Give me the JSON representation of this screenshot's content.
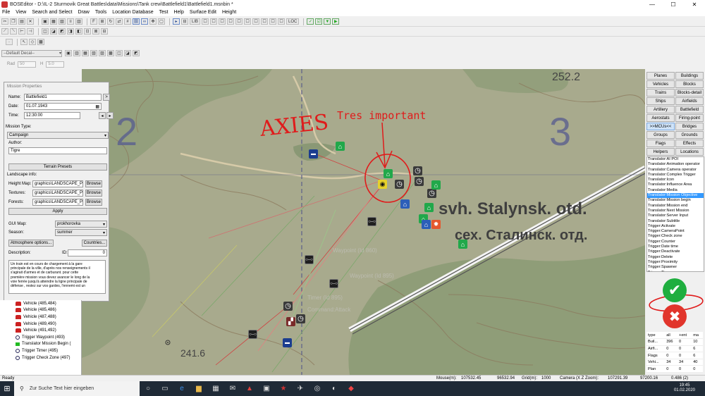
{
  "window": {
    "title": "BOSEditor - D:\\IL-2 Sturmovik Great Battles\\data\\Missions\\Tank crew\\Battlefield1\\Battlefield1.msnbin *",
    "controls": [
      "—",
      "☐",
      "✕"
    ]
  },
  "menu": [
    "File",
    "View",
    "Search and Select",
    "Draw",
    "Tools",
    "Location Database",
    "Test",
    "Help",
    "Surface Edit",
    "Height"
  ],
  "toolbar": {
    "text_buttons": [
      "LIB",
      "LOC"
    ]
  },
  "decal": {
    "selected": "--Default Decal--",
    "rad_label": "Rad",
    "rad_value": "50",
    "h_label": "H",
    "h_value": "5.0"
  },
  "mission": {
    "panel_title": "Mission Properties",
    "name_label": "Name:",
    "name_value": "Battlefield1",
    "date_label": "Date:",
    "date_value": "01.07.1943",
    "time_label": "Time:",
    "time_value": "12:30:00",
    "type_label": "Mission Type:",
    "type_value": "Campaign",
    "author_label": "Author:",
    "author_value": "Tigre",
    "terrain_presets": "Terrain Presets",
    "landscape_label": "Landscape info:",
    "heightmap_label": "Height Map:",
    "heightmap_value": "graphics\\LANDSCAPE_Prokh",
    "textures_label": "Textures:",
    "textures_value": "graphics\\LANDSCAPE_Prokh",
    "forests_label": "Forests:",
    "forests_value": "graphics\\LANDSCAPE_Prokh",
    "browse": "Browse",
    "apply": "Apply",
    "gui_map_label": "GUI Map:",
    "gui_map_value": "prokhorovka",
    "season_label": "Season:",
    "season_value": "summer",
    "atmo_button": "Atmosphere options...",
    "countries_button": "Countries...",
    "description_label": "Description:",
    "id_label": "ID:",
    "id_value": "0",
    "description_lines": [
      "Un train est en cours de chargement à la gare",
      "principale de la ville, d'après nos renseignements il",
      "s'agirait d'armes et de carburant.      pour cette",
      "première mission vous devez avancer le long de la",
      "voie ferrée jusqu'à atteindre la ligne principale de",
      "défense ,  restez sur vos gardes, l'ennemi est un"
    ]
  },
  "object_list": [
    {
      "icon": "tank-icon",
      "label": "Vehicle (485,484)"
    },
    {
      "icon": "tank-icon",
      "label": "Vehicle (485,486)"
    },
    {
      "icon": "tank-icon",
      "label": "Vehicle (487,488)"
    },
    {
      "icon": "tank-icon",
      "label": "Vehicle (489,490)"
    },
    {
      "icon": "tank-icon",
      "label": "Vehicle (491,492)"
    },
    {
      "icon": "waypoint-icon",
      "label": "Trigger Waypoint (493)"
    },
    {
      "icon": "flag-icon",
      "label": "Translator Mission Begin ("
    },
    {
      "icon": "timer-icon",
      "label": "Trigger Timer (495)"
    },
    {
      "icon": "check-icon",
      "label": "Trigger Check Zone (497)"
    }
  ],
  "categories": [
    {
      "left": "Planes",
      "right": "Buildings"
    },
    {
      "left": "Vehicles",
      "right": "Blocks"
    },
    {
      "left": "Trains",
      "right": "Blocks-detail"
    },
    {
      "left": "Ships",
      "right": "Airfields"
    },
    {
      "left": "Artillery",
      "right": "Battlefield"
    },
    {
      "left": "Aerostats",
      "right": "Firing-point"
    },
    {
      "left": ">>MCUs<<",
      "right": "Bridges"
    },
    {
      "left": "Groups",
      "right": "Grounds"
    },
    {
      "left": "Flags",
      "right": "Effects"
    },
    {
      "left": "Helpers",
      "right": "Locations"
    }
  ],
  "mcu_list": [
    "Translator:AI POI",
    "Translator:Animation operator",
    "Translator:Camera operator",
    "Translator:Complex Trigger",
    "Translator:Icon",
    "Translator:Influence Area",
    "Translator:Media",
    "Translator:Mission Objective",
    "Translator:Mission begin",
    "Translator:Mission end",
    "Translator:Next Mission",
    "Translator:Server Input",
    "Translator:Subtitle",
    "Trigger:Activate",
    "Trigger:CameraPoint",
    "Trigger:Check zone",
    "Trigger:Counter",
    "Trigger:Date time",
    "Trigger:Deactivate",
    "Trigger:Delete",
    "Trigger:Proximity",
    "Trigger:Spawner",
    "Trigger:Timer",
    "Trigger:Waypoint"
  ],
  "mcu_selected_index": 7,
  "stats": {
    "headers": [
      "type",
      "all",
      "+ent",
      "ma"
    ],
    "rows": [
      [
        "Buil...",
        "396",
        "0",
        "10"
      ],
      [
        "Airfi...",
        "0",
        "0",
        "6"
      ],
      [
        "Flags",
        "0",
        "0",
        "6"
      ],
      [
        "Vehi...",
        "34",
        "34",
        "40"
      ],
      [
        "Plan",
        "0",
        "0",
        "0"
      ]
    ]
  },
  "map": {
    "grid_numbers": [
      "2",
      "3"
    ],
    "heights": [
      "252.2",
      "241.6"
    ],
    "place_latin": "svh. Stalynsk. otd.",
    "place_cyrillic": "сех. Сталинск. отд.",
    "annotation_axies": "AXIES",
    "annotation_important": "Tres important",
    "faint_labels": [
      "Waypoint (Id 860)",
      "Waypoint (Id 895)",
      "Timer (Id 895)",
      "Command:Attack"
    ]
  },
  "status": {
    "ready": "Ready",
    "mouse_label": "Mouse(m):",
    "mouse_x": "107532.45",
    "mouse_z": "96532.94",
    "grid_label": "Grid(m):",
    "grid_value": "1000",
    "camera_label": "Camera (X  Z  Zoom):",
    "cam_x": "107291.39",
    "cam_z": "97200.16",
    "cam_zoom": "0.486 (2)"
  },
  "taskbar": {
    "search_placeholder": "Zur Suche Text hier eingeben",
    "time": "19:45",
    "date": "01.02.2020"
  },
  "colors": {
    "map_bg": "#a8aa8d",
    "forest": "#8e9c76",
    "selected_row": "#3399ff",
    "annotation_red": "#e01b1b",
    "ok_green": "#1fae3f",
    "cancel_red": "#e1352c"
  }
}
